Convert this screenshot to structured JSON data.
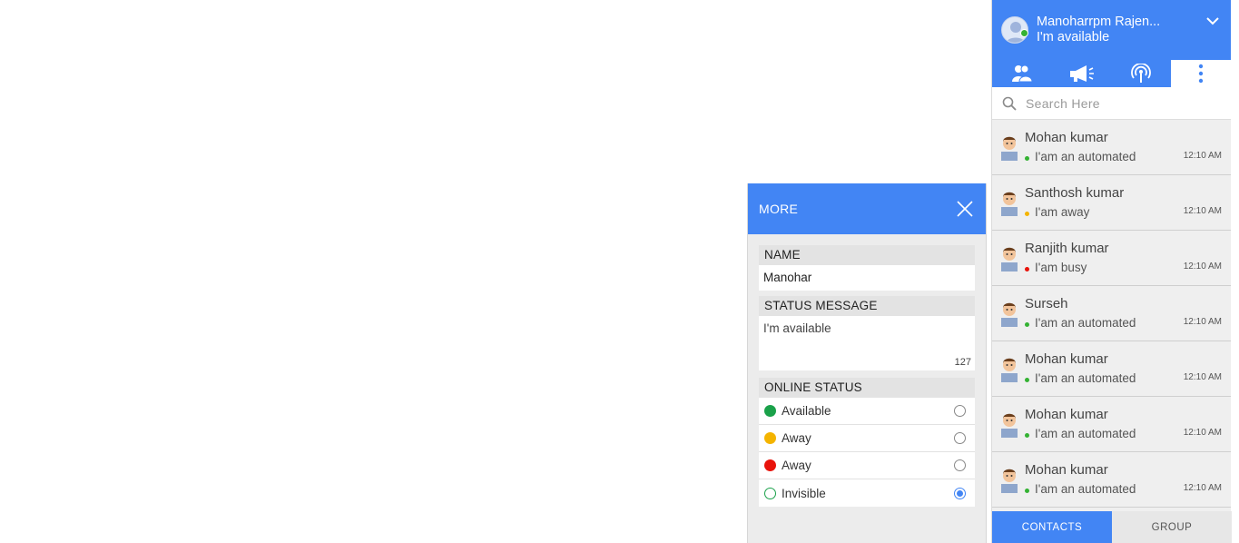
{
  "more_panel": {
    "title": "MORE",
    "name_label": "NAME",
    "name_value": "Manohar",
    "status_message_label": "STATUS MESSAGE",
    "status_message_value": "I'm available",
    "status_char_count": "127",
    "online_status_label": "ONLINE STATUS",
    "online_status_options": [
      {
        "label": "Available",
        "color": "#1aa14a",
        "selected": false
      },
      {
        "label": "Away",
        "color": "#f4b400",
        "selected": false
      },
      {
        "label": "Away",
        "color": "#e8130b",
        "selected": false
      },
      {
        "label": "Invisible",
        "color": "#1aa14a",
        "selected": true
      }
    ]
  },
  "profile": {
    "name": "Manoharrpm Rajen...",
    "status": "I'm available",
    "status_color": "#34b233"
  },
  "tabs": [
    {
      "icon": "contacts-icon"
    },
    {
      "icon": "megaphone-icon"
    },
    {
      "icon": "broadcast-icon"
    },
    {
      "icon": "more-vertical-icon",
      "active": true
    }
  ],
  "search": {
    "placeholder": "Search Here"
  },
  "contacts": [
    {
      "name": "Mohan kumar",
      "message": "I'am an automated",
      "time": "12:10 AM",
      "status_color": "#34b233"
    },
    {
      "name": "Santhosh kumar",
      "message": "I'am away",
      "time": "12:10 AM",
      "status_color": "#f4b400"
    },
    {
      "name": "Ranjith kumar",
      "message": "I'am busy",
      "time": "12:10 AM",
      "status_color": "#e8130b"
    },
    {
      "name": "Surseh",
      "message": "I'am an automated",
      "time": "12:10 AM",
      "status_color": "#34b233"
    },
    {
      "name": "Mohan kumar",
      "message": "I'am an automated",
      "time": "12:10 AM",
      "status_color": "#34b233"
    },
    {
      "name": "Mohan kumar",
      "message": "I'am an automated",
      "time": "12:10 AM",
      "status_color": "#34b233"
    },
    {
      "name": "Mohan kumar",
      "message": "I'am an automated",
      "time": "12:10 AM",
      "status_color": "#34b233"
    }
  ],
  "bottom_tabs": {
    "contacts": "CONTACTS",
    "group": "GROUP"
  }
}
